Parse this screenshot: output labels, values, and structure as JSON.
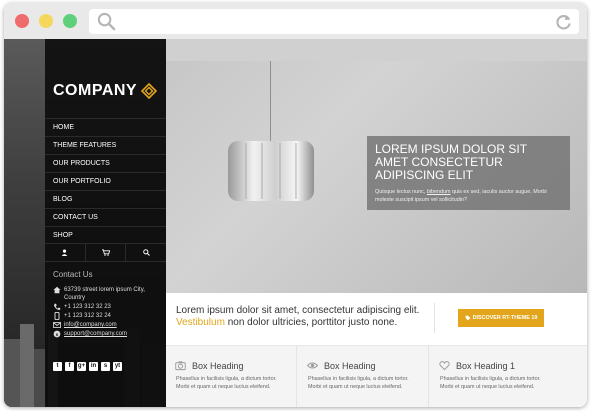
{
  "browser": {
    "url": ""
  },
  "site": {
    "logo": "COMPANY",
    "nav": [
      "HOME",
      "THEME FEATURES",
      "OUR PRODUCTS",
      "OUR PORTFOLIO",
      "BLOG",
      "CONTACT US",
      "SHOP"
    ],
    "contact": {
      "title": "Contact Us",
      "address": "63739 street lorem ipsum City, Country",
      "phone": "+1 123 312 32 23",
      "mobile": "+1 123 312 32 24",
      "email": "info@company.com",
      "skype": "support@company.com"
    },
    "social": [
      "t",
      "f",
      "g+",
      "in",
      "s",
      "yt"
    ]
  },
  "hero": {
    "title": "LOREM IPSUM DOLOR SIT AMET CONSECTETUR ADIPISCING ELIT",
    "text_before": "Quisque lectus nunc, ",
    "text_link": "bibendum",
    "text_after": " quis ex sed, iaculis auctor augue. Morbi moleste suscipit ipsum vel sollicitudin?"
  },
  "cta": {
    "text_main": "Lorem ipsum dolor sit amet, consectetur adipiscing elit.",
    "text_highlight": "Vestibulum",
    "text_rest": " non dolor ultricies, porttitor justo none.",
    "button": "DISCOVER RT-THEME 19"
  },
  "boxes": [
    {
      "heading": "Box Heading",
      "icon": "camera-icon",
      "text": "Phasellus in facilisis ligula, a dictum tortor. Morbi et quam ut neque luctus eleifend."
    },
    {
      "heading": "Box Heading",
      "icon": "eye-icon",
      "text": "Phasellus in facilisis ligula, a dictum tortor. Morbi et quam ut neque luctus eleifend."
    },
    {
      "heading": "Box Heading 1",
      "icon": "heart-icon",
      "text": "Phasellus in facilisis ligula, a dictum tortor. Morbi et quam ut neque luctus eleifend."
    }
  ],
  "colors": {
    "accent": "#e3a51c",
    "sidebar": "#0c0c0c"
  }
}
